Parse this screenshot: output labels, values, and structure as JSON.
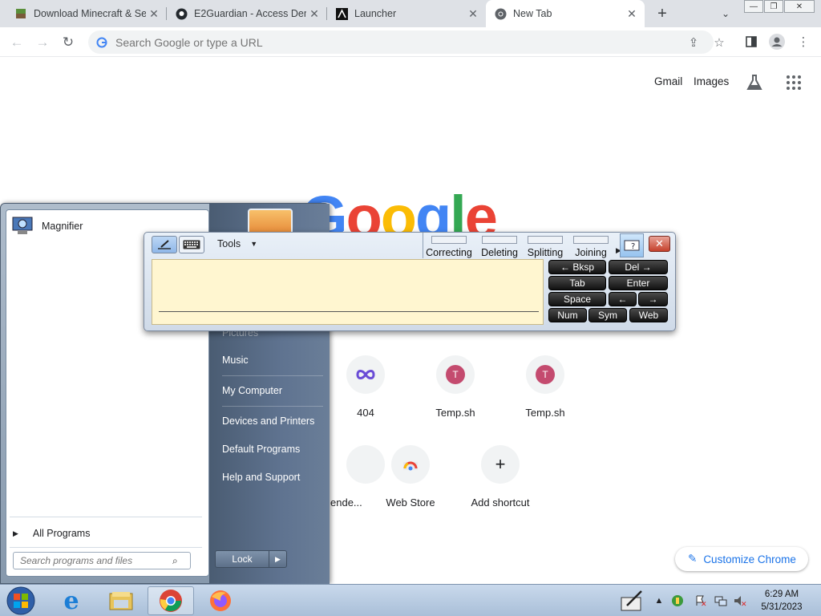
{
  "browser": {
    "tabs": [
      {
        "title": "Download Minecraft & Se",
        "icon": "minecraft-icon"
      },
      {
        "title": "E2Guardian - Access Den",
        "icon": "github-icon"
      },
      {
        "title": "Launcher",
        "icon": "launcher-icon"
      },
      {
        "title": "New Tab",
        "icon": "chrome-icon",
        "active": true
      }
    ],
    "new_tab_label": "+",
    "omnibox_placeholder": "Search Google or type a URL"
  },
  "ntp": {
    "gmail": "Gmail",
    "images": "Images",
    "logo": "Google",
    "shortcuts": [
      {
        "label": "404",
        "icon": "infinity-icon"
      },
      {
        "label": "Temp.sh",
        "letter": "T"
      },
      {
        "label": "Temp.sh",
        "letter": "T"
      },
      {
        "label": "ende...",
        "icon": "partial-icon"
      },
      {
        "label": "Web Store",
        "icon": "webstore-icon"
      },
      {
        "label": "Add shortcut",
        "icon": "plus-icon"
      }
    ],
    "customize": "Customize Chrome"
  },
  "start_menu": {
    "pinned": [
      {
        "label": "Magnifier",
        "icon": "magnifier-icon"
      }
    ],
    "all_programs": "All Programs",
    "search_placeholder": "Search programs and files",
    "right_items": [
      "Pictures",
      "Music",
      "My Computer",
      "Devices and Printers",
      "Default Programs",
      "Help and Support"
    ],
    "lock": "Lock"
  },
  "input_panel": {
    "tools": "Tools",
    "commands": [
      "Correcting",
      "Deleting",
      "Splitting",
      "Joining"
    ],
    "keys": {
      "bksp": "← Bksp",
      "del": "Del →",
      "tab": "Tab",
      "enter": "Enter",
      "space": "Space",
      "left": "←",
      "right": "→",
      "num": "Num",
      "sym": "Sym",
      "web": "Web"
    }
  },
  "taskbar": {
    "time": "6:29 AM",
    "date": "5/31/2023"
  }
}
